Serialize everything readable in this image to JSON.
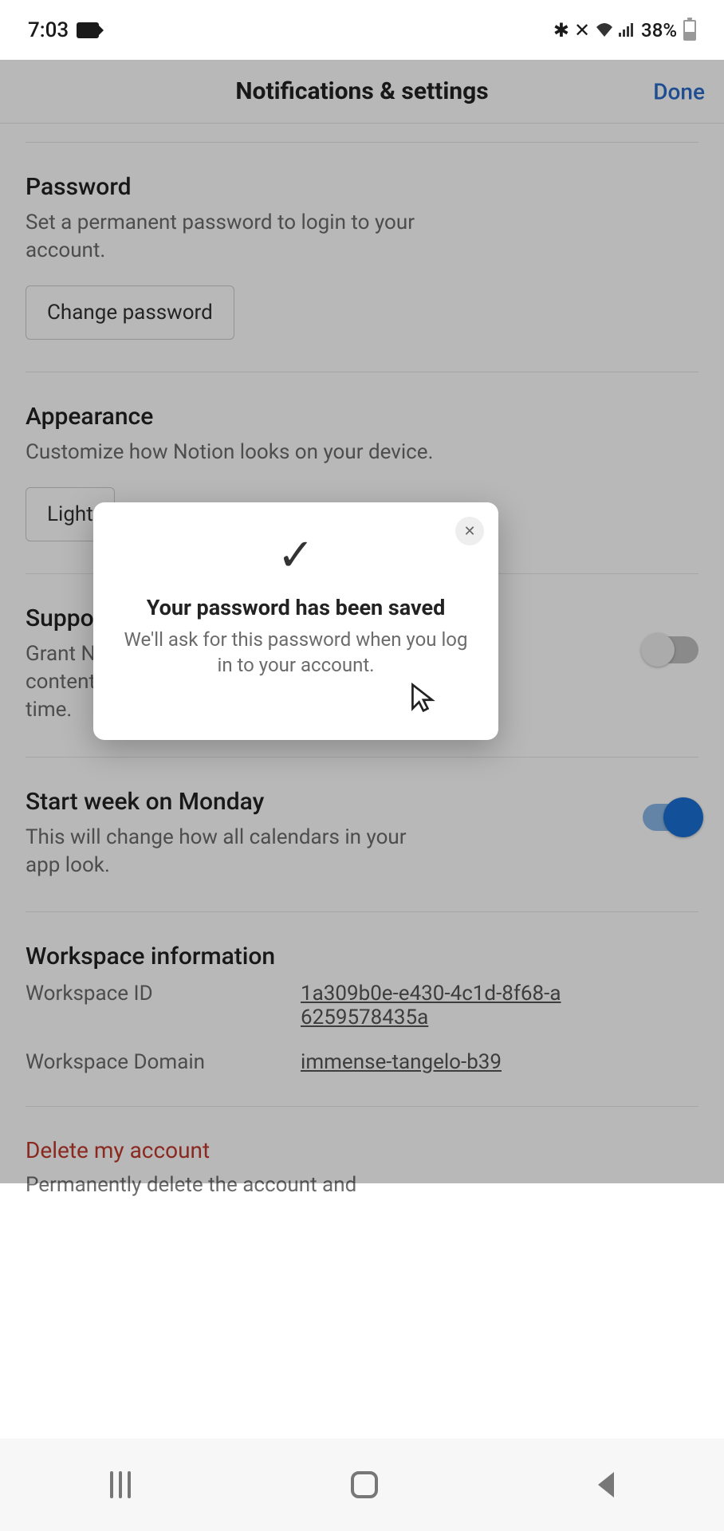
{
  "status_bar": {
    "time": "7:03",
    "battery": "38%"
  },
  "header": {
    "title": "Notifications & settings",
    "done": "Done"
  },
  "sections": {
    "password": {
      "title": "Password",
      "desc": "Set a permanent password to login to your account.",
      "button": "Change password"
    },
    "appearance": {
      "title": "Appearance",
      "desc": "Customize how Notion looks on your device.",
      "value": "Light"
    },
    "support": {
      "title": "Suppor",
      "desc": "Grant Nc access t troubles content revoke access at any time."
    },
    "week": {
      "title": "Start week on Monday",
      "desc": "This will change how all calendars in your app look."
    },
    "workspace": {
      "title": "Workspace information",
      "id_label": "Workspace ID",
      "id_value": "1a309b0e-e430-4c1d-8f68-a6259578435a",
      "domain_label": "Workspace Domain",
      "domain_value": "immense-tangelo-b39"
    },
    "delete": {
      "title": "Delete my account",
      "desc": "Permanently delete the account and"
    }
  },
  "modal": {
    "title": "Your password has been saved",
    "desc": "We'll ask for this password when you log in to your account."
  }
}
